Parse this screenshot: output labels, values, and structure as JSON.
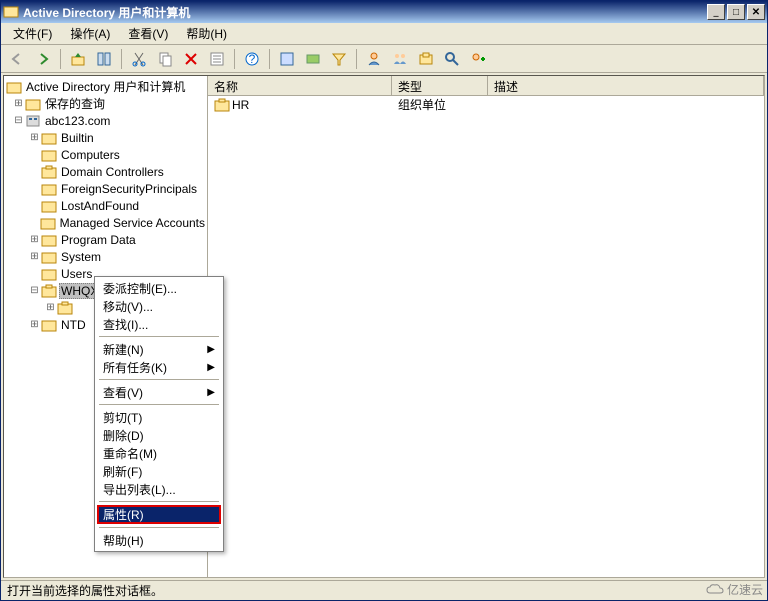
{
  "window": {
    "title": "Active Directory 用户和计算机"
  },
  "menubar": {
    "file": "文件(F)",
    "action": "操作(A)",
    "view": "查看(V)",
    "help": "帮助(H)"
  },
  "tree": {
    "root": "Active Directory 用户和计算机",
    "saved_queries": "保存的查询",
    "domain": "abc123.com",
    "nodes": {
      "builtin": "Builtin",
      "computers": "Computers",
      "domain_controllers": "Domain Controllers",
      "fsp": "ForeignSecurityPrincipals",
      "lostfound": "LostAndFound",
      "msa": "Managed Service Accounts",
      "program_data": "Program Data",
      "system": "System",
      "users": "Users",
      "whqx": "WHQX",
      "ntd": "NTD"
    }
  },
  "list": {
    "cols": {
      "name": "名称",
      "type": "类型",
      "desc": "描述"
    },
    "rows": [
      {
        "name": "HR",
        "type": "组织单位",
        "desc": ""
      }
    ]
  },
  "context_menu": {
    "items": {
      "delegate": "委派控制(E)...",
      "move": "移动(V)...",
      "find": "查找(I)...",
      "new": "新建(N)",
      "all_tasks": "所有任务(K)",
      "view": "查看(V)",
      "cut": "剪切(T)",
      "delete": "删除(D)",
      "rename": "重命名(M)",
      "refresh": "刷新(F)",
      "export": "导出列表(L)...",
      "properties": "属性(R)",
      "help": "帮助(H)"
    }
  },
  "statusbar": {
    "text": "打开当前选择的属性对话框。"
  },
  "watermark": "亿速云"
}
